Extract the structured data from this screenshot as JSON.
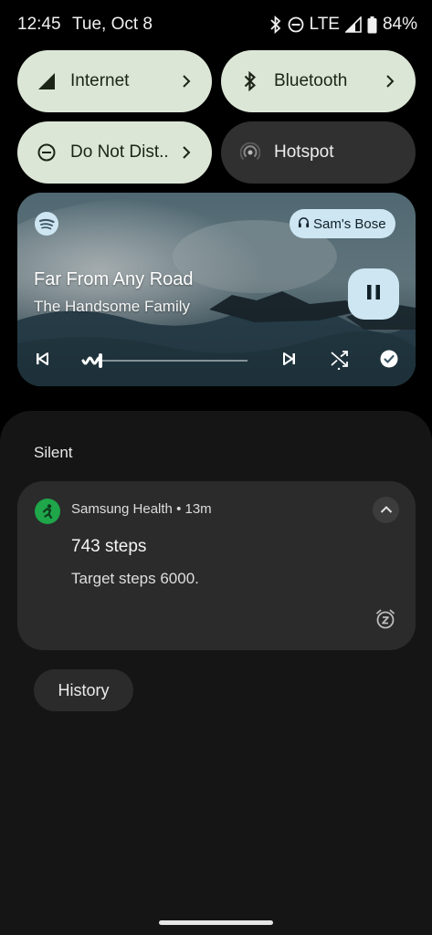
{
  "status_bar": {
    "time": "12:45",
    "date": "Tue, Oct 8",
    "network": "LTE",
    "battery": "84%",
    "icons": [
      "bluetooth-icon",
      "do-not-disturb-icon",
      "signal-icon",
      "battery-icon"
    ]
  },
  "quick_settings": {
    "tiles": [
      {
        "label": "Internet",
        "icon": "signal-icon",
        "state": "on"
      },
      {
        "label": "Bluetooth",
        "icon": "bluetooth-icon",
        "state": "on"
      },
      {
        "label": "Do Not Dist..",
        "icon": "do-not-disturb-icon",
        "state": "on"
      },
      {
        "label": "Hotspot",
        "icon": "hotspot-icon",
        "state": "off"
      }
    ]
  },
  "media": {
    "app_icon": "spotify-icon",
    "output_device": "Sam's Bose",
    "song_title": "Far From Any Road",
    "artist": "The Handsome Family",
    "progress_fraction": 0.1,
    "controls": [
      "previous-icon",
      "pause-icon",
      "next-icon",
      "shuffle-icon",
      "saved-check-icon"
    ]
  },
  "notifications": {
    "section_label": "Silent",
    "items": [
      {
        "app": "Samsung Health",
        "time": "13m",
        "title": "743 steps",
        "text": "Target steps 6000.",
        "accent": "#1fa54a"
      }
    ],
    "history_label": "History"
  },
  "colors": {
    "tile_on": "#dce6d6",
    "tile_off": "#303030",
    "media_accent": "#cde6f2",
    "shade_bg": "#151515"
  }
}
